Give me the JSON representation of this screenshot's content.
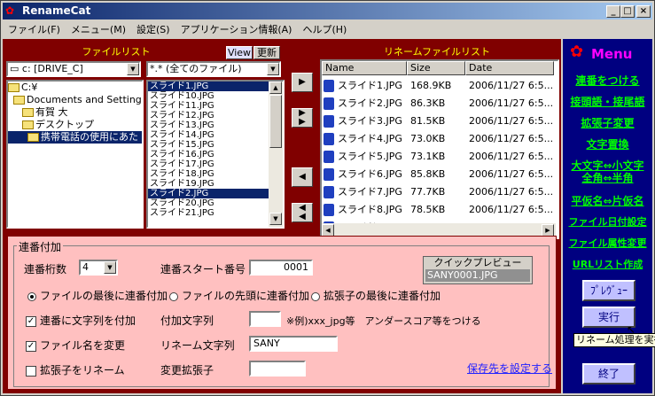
{
  "app": {
    "title": "RenameCat"
  },
  "menu": [
    "ファイル(F)",
    "メニュー(M)",
    "設定(S)",
    "アプリケーション情報(A)",
    "ヘルプ(H)"
  ],
  "file_list": {
    "title": "ファイルリスト",
    "view_btn": "View",
    "refresh_btn": "更新",
    "drive": "c: [DRIVE_C]",
    "filter": "*.* (全てのファイル)",
    "tree": [
      "C:¥",
      "Documents and Settings",
      "有賀 大",
      "デスクトップ",
      "携帯電話の使用にあた"
    ],
    "files": [
      "スライド1.JPG",
      "スライド10.JPG",
      "スライド11.JPG",
      "スライド12.JPG",
      "スライド13.JPG",
      "スライド14.JPG",
      "スライド15.JPG",
      "スライド16.JPG",
      "スライド17.JPG",
      "スライド18.JPG",
      "スライド19.JPG",
      "スライド2.JPG",
      "スライド20.JPG",
      "スライド21.JPG"
    ]
  },
  "rename_list": {
    "title": "リネームファイルリスト",
    "columns": [
      "Name",
      "Size",
      "Date"
    ],
    "rows": [
      {
        "name": "スライド1.JPG",
        "size": "168.9KB",
        "date": "2006/11/27 6:5..."
      },
      {
        "name": "スライド2.JPG",
        "size": "86.3KB",
        "date": "2006/11/27 6:5..."
      },
      {
        "name": "スライド3.JPG",
        "size": "81.5KB",
        "date": "2006/11/27 6:5..."
      },
      {
        "name": "スライド4.JPG",
        "size": "73.0KB",
        "date": "2006/11/27 6:5..."
      },
      {
        "name": "スライド5.JPG",
        "size": "73.1KB",
        "date": "2006/11/27 6:5..."
      },
      {
        "name": "スライド6.JPG",
        "size": "85.8KB",
        "date": "2006/11/27 6:5..."
      },
      {
        "name": "スライド7.JPG",
        "size": "77.7KB",
        "date": "2006/11/27 6:5..."
      },
      {
        "name": "スライド8.JPG",
        "size": "78.5KB",
        "date": "2006/11/27 6:5..."
      },
      {
        "name": "スライド9.JPG",
        "size": "81.6KB",
        "date": "2006/11/27 6:5..."
      }
    ]
  },
  "serial": {
    "group": "連番付加",
    "digits_label": "連番桁数",
    "digits_value": "4",
    "start_label": "連番スタート番号",
    "start_value": "0001",
    "preview_title": "クイックプレビュー",
    "preview_value": "SANY0001.JPG",
    "radio1": "ファイルの最後に連番付加",
    "radio2": "ファイルの先頭に連番付加",
    "radio3": "拡張子の最後に連番付加",
    "chk1": "連番に文字列を付加",
    "add_label": "付加文字列",
    "add_hint": "※例)xxx_jpg等　アンダースコア等をつける",
    "chk2": "ファイル名を変更",
    "rename_label": "リネーム文字列",
    "rename_value": "SANY",
    "chk3": "拡張子をリネーム",
    "ext_label": "変更拡張子",
    "save_link": "保存先を設定する"
  },
  "side": {
    "menu_title": "Menu",
    "links": [
      "連番をつける",
      "接頭語・接尾語",
      "拡張子変更",
      "文字置換",
      "大文字⇔小文字",
      "全角⇔半角",
      "平仮名⇔片仮名",
      "ファイル日付設定",
      "ファイル属性変更",
      "URLリスト作成"
    ],
    "preview_btn": "ﾌﾟﾚｳﾞｭｰ",
    "exec_btn": "実行",
    "end_btn": "終了",
    "tooltip": "リネーム処理を実行"
  }
}
